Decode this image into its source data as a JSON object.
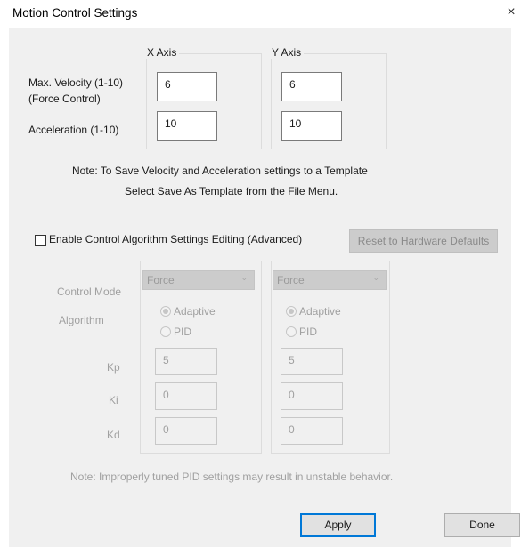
{
  "window": {
    "title": "Motion Control Settings",
    "close_glyph": "×"
  },
  "motion": {
    "x_axis_label": "X Axis",
    "y_axis_label": "Y Axis",
    "velocity_label_line1": "Max. Velocity (1-10)",
    "velocity_label_line2": "(Force Control)",
    "acceleration_label": "Acceleration (1-10)",
    "x_velocity": "6",
    "y_velocity": "6",
    "x_acceleration": "10",
    "y_acceleration": "10",
    "note_line1": "Note:  To Save Velocity and Acceleration settings to a Template",
    "note_line2": "Select Save As Template from the File Menu."
  },
  "advanced": {
    "enable_checkbox_label": "Enable Control Algorithm Settings Editing (Advanced)",
    "enable_checked": false,
    "reset_button_label": "Reset to Hardware Defaults",
    "control_mode_label": "Control Mode",
    "algorithm_label": "Algorithm",
    "kp_label": "Kp",
    "ki_label": "Ki",
    "kd_label": "Kd",
    "x": {
      "control_mode": "Force",
      "algorithm_options": [
        "Adaptive",
        "PID"
      ],
      "algorithm_selected": "Adaptive",
      "kp": "5",
      "ki": "0",
      "kd": "0"
    },
    "y": {
      "control_mode": "Force",
      "algorithm_options": [
        "Adaptive",
        "PID"
      ],
      "algorithm_selected": "Adaptive",
      "kp": "5",
      "ki": "0",
      "kd": "0"
    },
    "pid_note": "Note:  Improperly tuned PID settings may result in unstable behavior."
  },
  "footer": {
    "apply_label": "Apply",
    "done_label": "Done"
  },
  "icons": {
    "close": "close-icon",
    "dropdown": "chevron-down-icon",
    "radio_selected": "radio-selected-icon",
    "radio_unselected": "radio-unselected-icon"
  },
  "colors": {
    "dialog_bg": "#f0f0f0",
    "default_button_border": "#0078d7",
    "disabled_text": "#a0a0a0"
  }
}
